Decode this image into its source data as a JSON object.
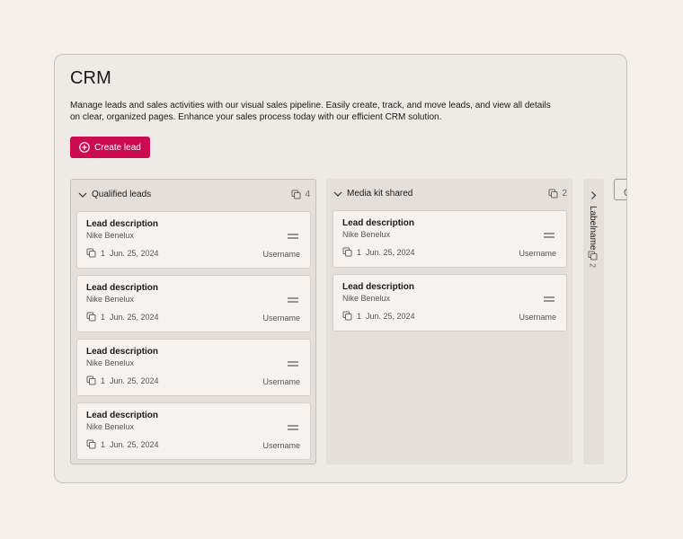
{
  "app": {
    "title": "CRM",
    "description": "Manage leads and sales activities with our visual sales pipeline. Easily create, track, and move leads, and view all details on clear, organized pages. Enhance your sales process today with our efficient CRM solution."
  },
  "toolbar": {
    "create_label": "Create lead",
    "create_icon": "plus-circle-icon",
    "accent": "#cc0a4f"
  },
  "columns": [
    {
      "title": "Qualified leads",
      "count": "4",
      "cards": [
        {
          "title": "Lead description",
          "company": "Nike Benelux",
          "count": "1",
          "date": "Jun. 25, 2024",
          "user": "Username"
        },
        {
          "title": "Lead description",
          "company": "Nike Benelux",
          "count": "1",
          "date": "Jun. 25, 2024",
          "user": "Username"
        },
        {
          "title": "Lead description",
          "company": "Nike Benelux",
          "count": "1",
          "date": "Jun. 25, 2024",
          "user": "Username"
        },
        {
          "title": "Lead description",
          "company": "Nike Benelux",
          "count": "1",
          "date": "Jun. 25, 2024",
          "user": "Username"
        }
      ]
    },
    {
      "title": "Media kit shared",
      "count": "2",
      "cards": [
        {
          "title": "Lead description",
          "company": "Nike Benelux",
          "count": "1",
          "date": "Jun. 25, 2024",
          "user": "Username"
        },
        {
          "title": "Lead description",
          "company": "Nike Benelux",
          "count": "1",
          "date": "Jun. 25, 2024",
          "user": "Username"
        }
      ]
    }
  ],
  "collapsed_column": {
    "label": "Labelname",
    "count": "2"
  },
  "icons": {
    "expand": "chevron-down-icon",
    "collapsed": "chevron-right-icon",
    "count": "copy-icon",
    "drag": "drag-handle-icon"
  }
}
